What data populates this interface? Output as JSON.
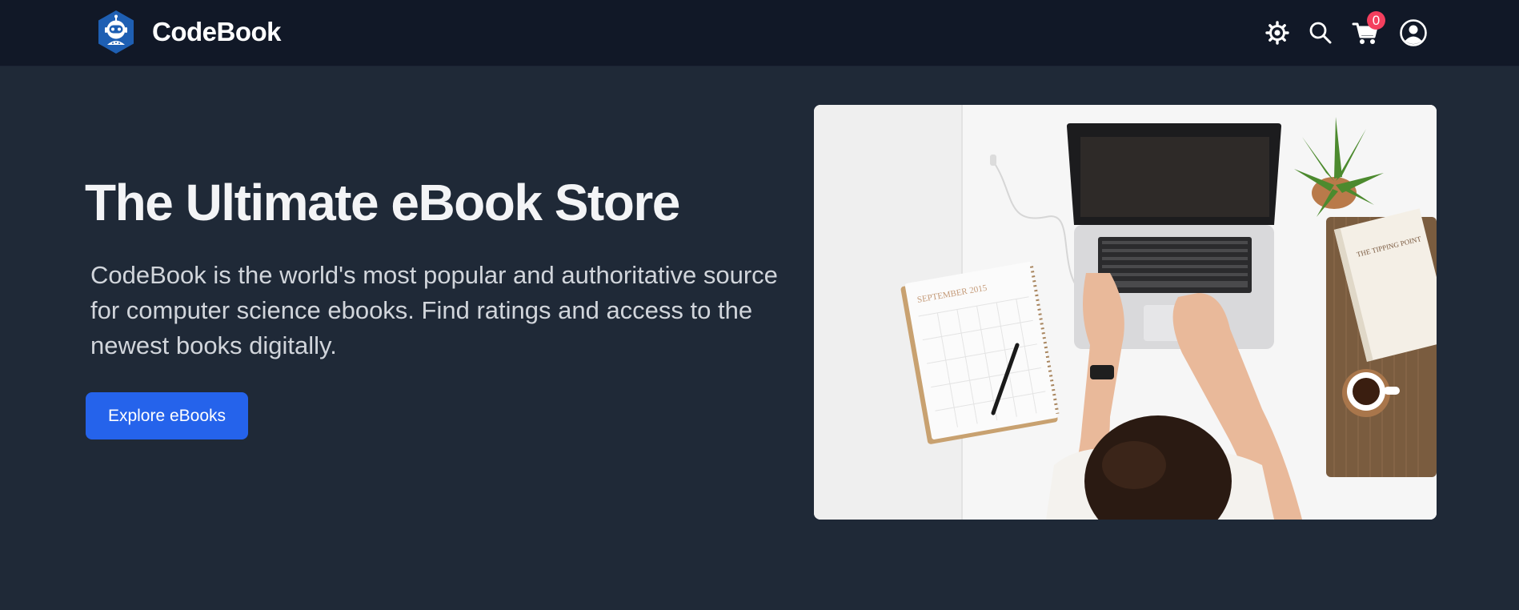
{
  "header": {
    "brand_name": "CodeBook",
    "icons": {
      "logo": "robot-logo-icon",
      "settings": "gear-icon",
      "search": "search-icon",
      "cart": "cart-icon",
      "account": "user-circle-icon"
    },
    "cart_count": "0"
  },
  "hero": {
    "title": "The Ultimate eBook Store",
    "description": "CodeBook is the world's most popular and authoritative source for computer science ebooks. Find ratings and access to the newest books digitally.",
    "cta_label": "Explore eBooks",
    "image": {
      "notebook_text": "SEPTEMBER 2015",
      "book_text": "THE TIPPING POINT"
    }
  },
  "colors": {
    "page_background": "#1f2937",
    "header_background": "#111827",
    "accent": "#2563eb",
    "badge": "#f43f5e",
    "logo": "#1e5fb3"
  }
}
